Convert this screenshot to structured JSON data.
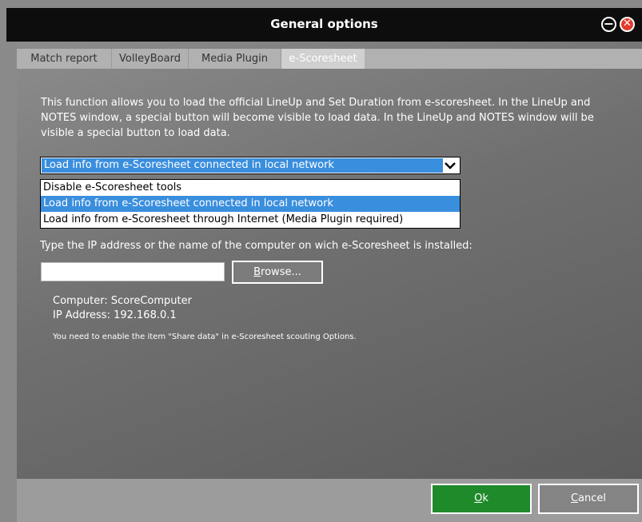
{
  "window": {
    "title": "General options",
    "minimize_icon": "minus-circle-icon",
    "close_icon": "close-circle-icon"
  },
  "tabs": [
    {
      "label": "Match report",
      "active": false
    },
    {
      "label": "VolleyBoard",
      "active": false
    },
    {
      "label": "Media Plugin",
      "active": false
    },
    {
      "label": "e-Scoresheet",
      "active": true
    }
  ],
  "escoresheet": {
    "description": "This function allows you to load the official LineUp and Set Duration from e-scoresheet. In the LineUp and NOTES window, a special button will become visible to load data. In the LineUp and NOTES window will be visible a special button to load data.",
    "mode_select": {
      "selected": "Load info from e-Scoresheet connected in local network",
      "options": [
        "Disable e-Scoresheet tools",
        "Load info from e-Scoresheet connected in local network",
        "Load info from e-Scoresheet through Internet (Media Plugin required)"
      ]
    },
    "ip_label": "Type the IP address or the name of the computer on wich e-Scoresheet is installed:",
    "ip_value": "",
    "browse_label_mnemonic": "B",
    "browse_label_rest": "rowse...",
    "computer_line": "Computer: ScoreComputer",
    "ip_line": "IP Address: 192.168.0.1",
    "hint": "You need to enable the item \"Share data\" in e-Scoresheet scouting Options."
  },
  "footer": {
    "ok_mnemonic": "O",
    "ok_rest": "k",
    "cancel_mnemonic": "C",
    "cancel_rest": "ancel"
  },
  "colors": {
    "accent_select": "#3a8ede",
    "ok_button": "#1f8a2a",
    "close_button": "#e23b2b",
    "titlebar": "#0d0d0d"
  }
}
